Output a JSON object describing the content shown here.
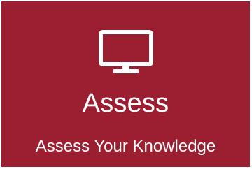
{
  "tile": {
    "icon": "monitor-icon",
    "title": "Assess",
    "subtitle": "Assess Your Knowledge",
    "colors": {
      "background": "#9b1f31",
      "text": "#ffffff"
    }
  }
}
